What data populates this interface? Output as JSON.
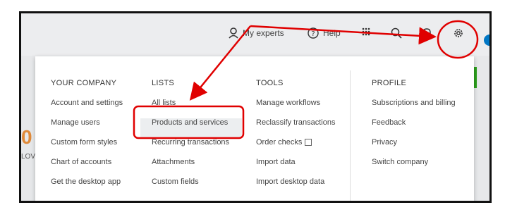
{
  "background": {
    "number": "0",
    "low_text": "LOV"
  },
  "topbar": {
    "my_experts": "My experts",
    "help": "Help"
  },
  "menu": {
    "columns": [
      {
        "heading": "YOUR COMPANY",
        "items": [
          "Account and settings",
          "Manage users",
          "Custom form styles",
          "Chart of accounts",
          "Get the desktop app"
        ]
      },
      {
        "heading": "LISTS",
        "items": [
          "All lists",
          "Products and services",
          "Recurring transactions",
          "Attachments",
          "Custom fields"
        ]
      },
      {
        "heading": "TOOLS",
        "items": [
          "Manage workflows",
          "Reclassify transactions",
          "Order checks",
          "Import data",
          "Import desktop data"
        ]
      },
      {
        "heading": "PROFILE",
        "items": [
          "Subscriptions and billing",
          "Feedback",
          "Privacy",
          "Switch company"
        ]
      }
    ]
  },
  "colors": {
    "annotation": "#e00000",
    "accent_green": "#2ca01c",
    "accent_blue": "#0077c5"
  }
}
